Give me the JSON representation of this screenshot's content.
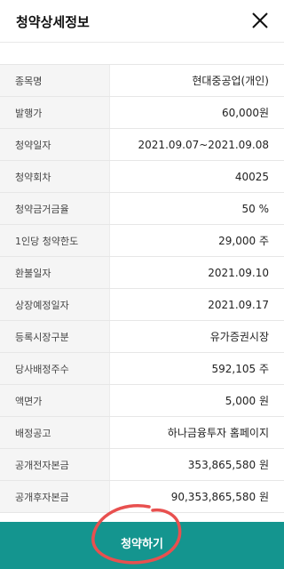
{
  "header": {
    "title": "청약상세정보"
  },
  "rows": [
    {
      "label": "종목명",
      "value": "현대중공업(개인)"
    },
    {
      "label": "발행가",
      "value": "60,000원"
    },
    {
      "label": "청약일자",
      "value": "2021.09.07~2021.09.08"
    },
    {
      "label": "청약회차",
      "value": "40025"
    },
    {
      "label": "청약금거금율",
      "value": "50 %"
    },
    {
      "label": "1인당 청약한도",
      "value": "29,000 주"
    },
    {
      "label": "환불일자",
      "value": "2021.09.10"
    },
    {
      "label": "상장예정일자",
      "value": "2021.09.17"
    },
    {
      "label": "등록시장구분",
      "value": "유가증권시장"
    },
    {
      "label": "당사배정주수",
      "value": "592,105 주"
    },
    {
      "label": "액면가",
      "value": "5,000 원"
    },
    {
      "label": "배정공고",
      "value": "하나금융투자 홈페이지"
    },
    {
      "label": "공개전자본금",
      "value": "353,865,580 원"
    },
    {
      "label": "공개후자본금",
      "value": "90,353,865,580 원"
    }
  ],
  "bottom": {
    "button_label": "청약하기",
    "color": "#14958f"
  },
  "annotation": {
    "circle_color": "#e8504f"
  }
}
